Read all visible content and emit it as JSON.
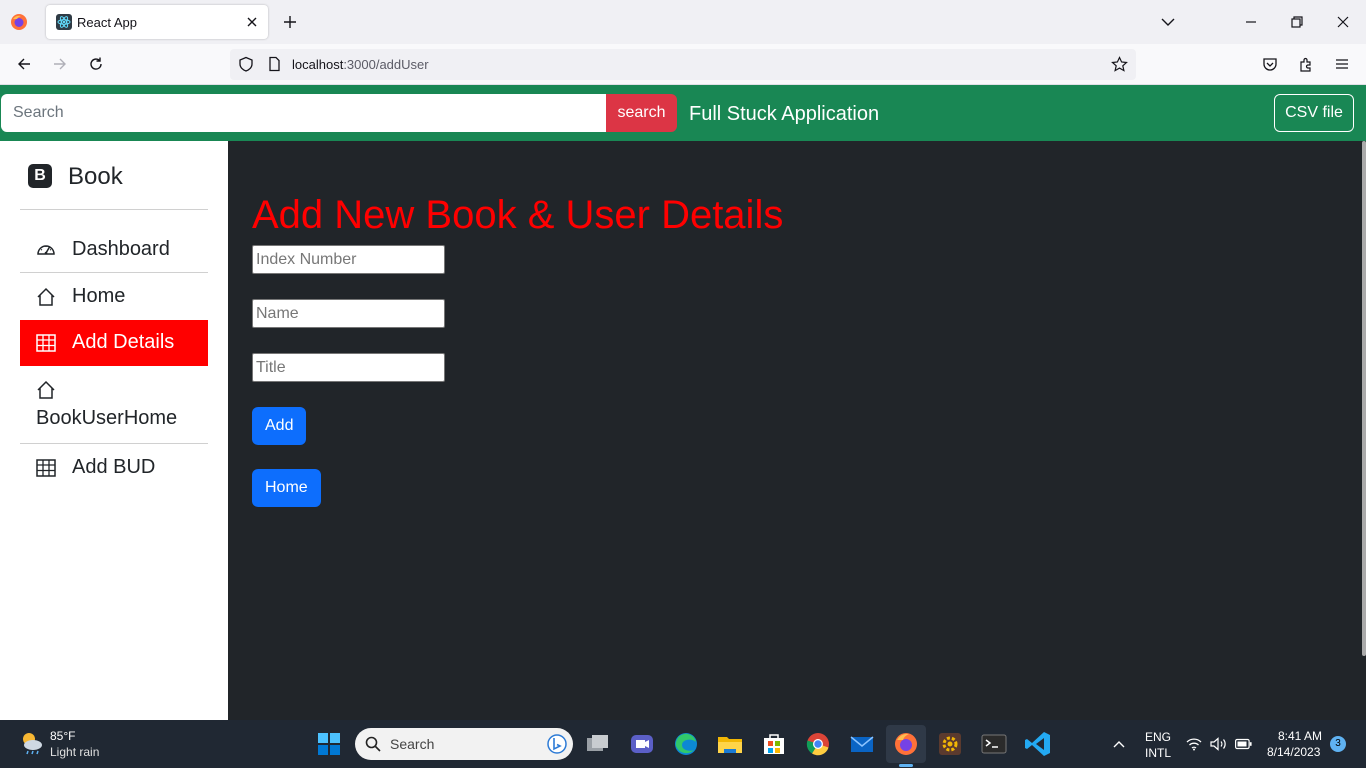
{
  "browser": {
    "tab_title": "React App",
    "url_host": "localhost",
    "url_path": ":3000/addUser"
  },
  "header": {
    "search_placeholder": "Search",
    "search_button": "search",
    "brand": "Full Stuck Application",
    "csv_button": "CSV file"
  },
  "sidebar": {
    "brand_letter": "B",
    "brand": "Book",
    "items": [
      {
        "label": "Dashboard",
        "icon": "speedometer-icon"
      },
      {
        "label": "Home",
        "icon": "house-icon"
      },
      {
        "label": "Add Details",
        "icon": "table-icon",
        "active": true
      },
      {
        "label": "BookUserHome",
        "icon": "house-icon"
      },
      {
        "label": "Add BUD",
        "icon": "table-icon"
      }
    ]
  },
  "main": {
    "heading": "Add New Book & User Details",
    "fields": [
      {
        "placeholder": "Index Number"
      },
      {
        "placeholder": "Name"
      },
      {
        "placeholder": "Title"
      }
    ],
    "add_button": "Add",
    "home_button": "Home"
  },
  "taskbar": {
    "weather_temp": "85°F",
    "weather_desc": "Light rain",
    "search_label": "Search",
    "lang_top": "ENG",
    "lang_bottom": "INTL",
    "time": "8:41 AM",
    "date": "8/14/2023",
    "notification_count": "3"
  },
  "colors": {
    "header_green": "#198754",
    "search_red": "#dc3545",
    "active_red": "#ff0000",
    "main_dark": "#212529",
    "primary_blue": "#0d6efd"
  }
}
